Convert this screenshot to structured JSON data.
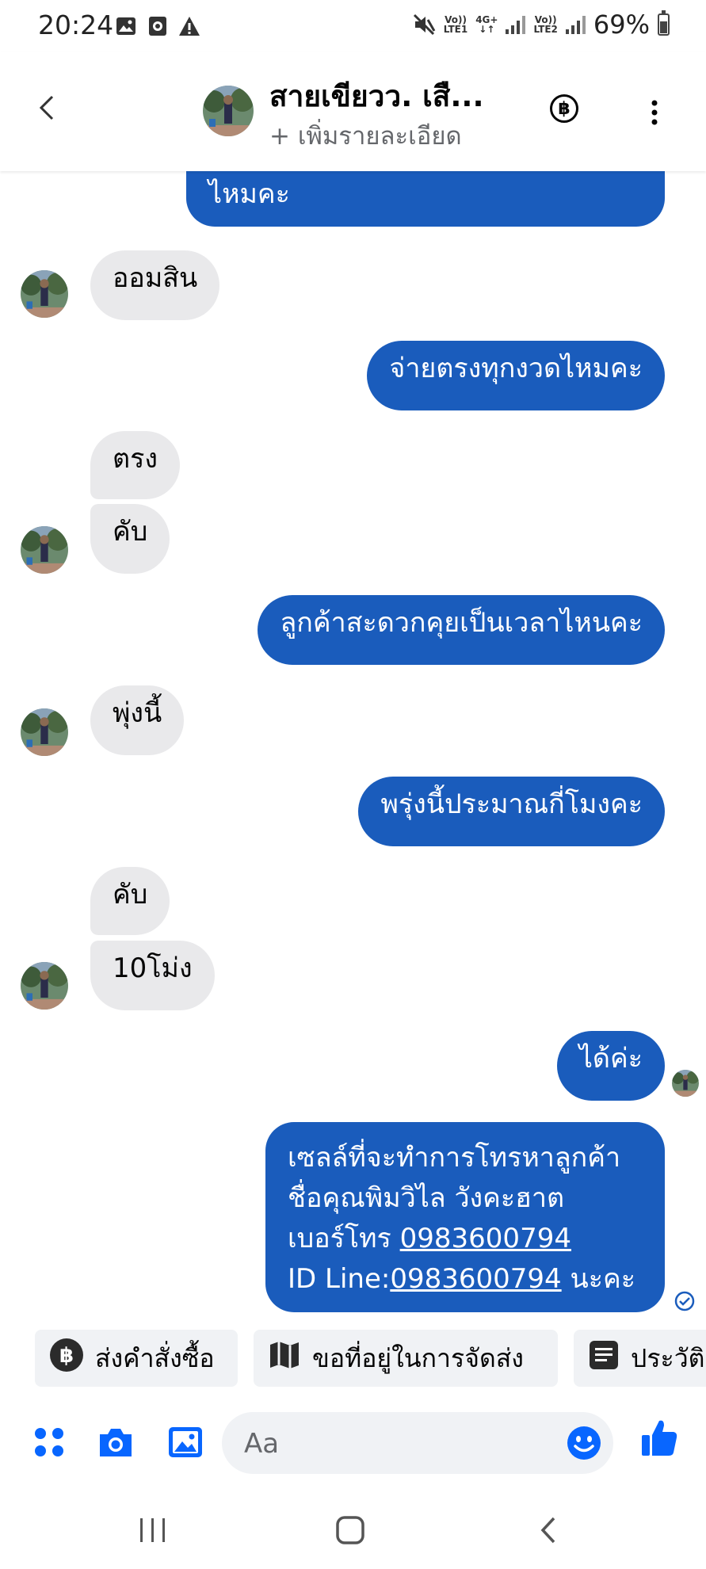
{
  "status_bar": {
    "time": "20:24",
    "notification_icons": [
      "gallery-icon",
      "screen-record-icon",
      "warning-icon"
    ],
    "sim1_label_top": "Vo))",
    "sim1_label_bottom": "LTE1",
    "net_top": "4G+",
    "net_bottom": "↓↑",
    "sim2_label_top": "Vo))",
    "sim2_label_bottom": "LTE2",
    "battery_percent": "69%",
    "battery_level": 0.69
  },
  "header": {
    "contact_name": "สายเขียวว. เสื...",
    "subtitle": "+ เพิ่มรายละเอียด",
    "payment_icon_text": "฿"
  },
  "messages": [
    {
      "side": "out",
      "text": "ไหมคะ"
    },
    {
      "side": "in",
      "text": "ออมสิน"
    },
    {
      "side": "out",
      "text": "จ่ายตรงทุกงวดไหมคะ"
    },
    {
      "side": "in",
      "text": "ตรง"
    },
    {
      "side": "in",
      "text": "คับ"
    },
    {
      "side": "out",
      "text": "ลูกค้าสะดวกคุยเป็นเวลาไหนคะ"
    },
    {
      "side": "in",
      "text": "พุ่งนี้"
    },
    {
      "side": "out",
      "text": "พรุ่งนี้ประมาณกี่โมงคะ"
    },
    {
      "side": "in",
      "text": "คับ"
    },
    {
      "side": "in",
      "text": "10โม่ง"
    },
    {
      "side": "out",
      "text": "ได้ค่ะ"
    },
    {
      "side": "out",
      "line1": "เซลล์ที่จะทำการโทรหาลูกค้า",
      "line2": "ชื่อคุณพิมวิไล วังคะฮาต",
      "line3_prefix": "เบอร์โทร ",
      "line3_link": "0983600794",
      "line4_prefix": "ID Line:",
      "line4_link": "0983600794",
      "line4_suffix": " นะคะ"
    }
  ],
  "quick_replies": [
    {
      "icon": "baht-icon",
      "label": "ส่งคำสั่งซื้อ"
    },
    {
      "icon": "map-icon",
      "label": "ขอที่อยู่ในการจัดส่ง"
    },
    {
      "icon": "document-icon",
      "label": "ประวัติ"
    }
  ],
  "composer": {
    "placeholder": "Aa",
    "icons": [
      "apps-icon",
      "camera-icon",
      "gallery-icon",
      "emoji-icon",
      "thumbs-up-icon"
    ]
  },
  "nav_bar": {
    "buttons": [
      "recents-button",
      "home-button",
      "back-button"
    ]
  },
  "colors": {
    "outgoing_bubble": "#1a5cbc",
    "incoming_bubble": "#e9e9eb",
    "accent": "#0866ff"
  }
}
